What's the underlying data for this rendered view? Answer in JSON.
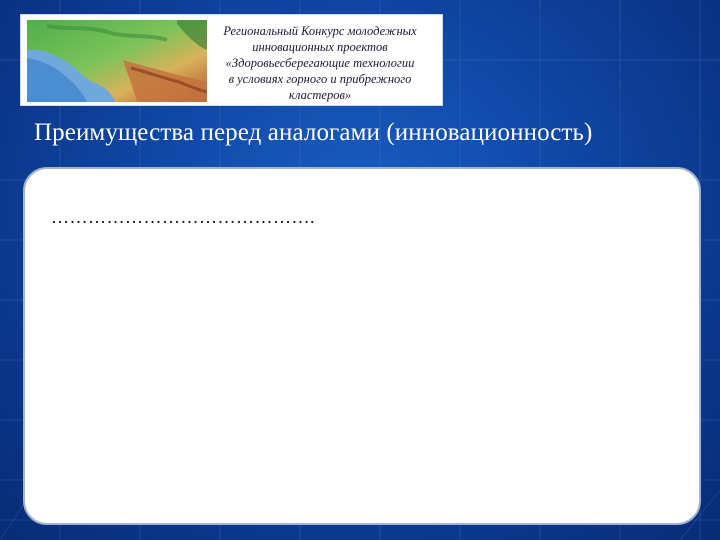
{
  "banner": {
    "lines": [
      "Региональный Конкурс молодежных",
      "инновационных проектов",
      "«Здоровьесберегающие технологии",
      "в условиях горного и прибрежного",
      "кластеров»"
    ]
  },
  "slide": {
    "title": "Преимущества перед аналогами (инновационность)",
    "body_placeholder": "……………………………………."
  },
  "colors": {
    "background": "#0f46a3",
    "content_box": "#ffffff",
    "content_border": "#9fb4cf"
  },
  "icons": {
    "map": "relief-map-image"
  }
}
